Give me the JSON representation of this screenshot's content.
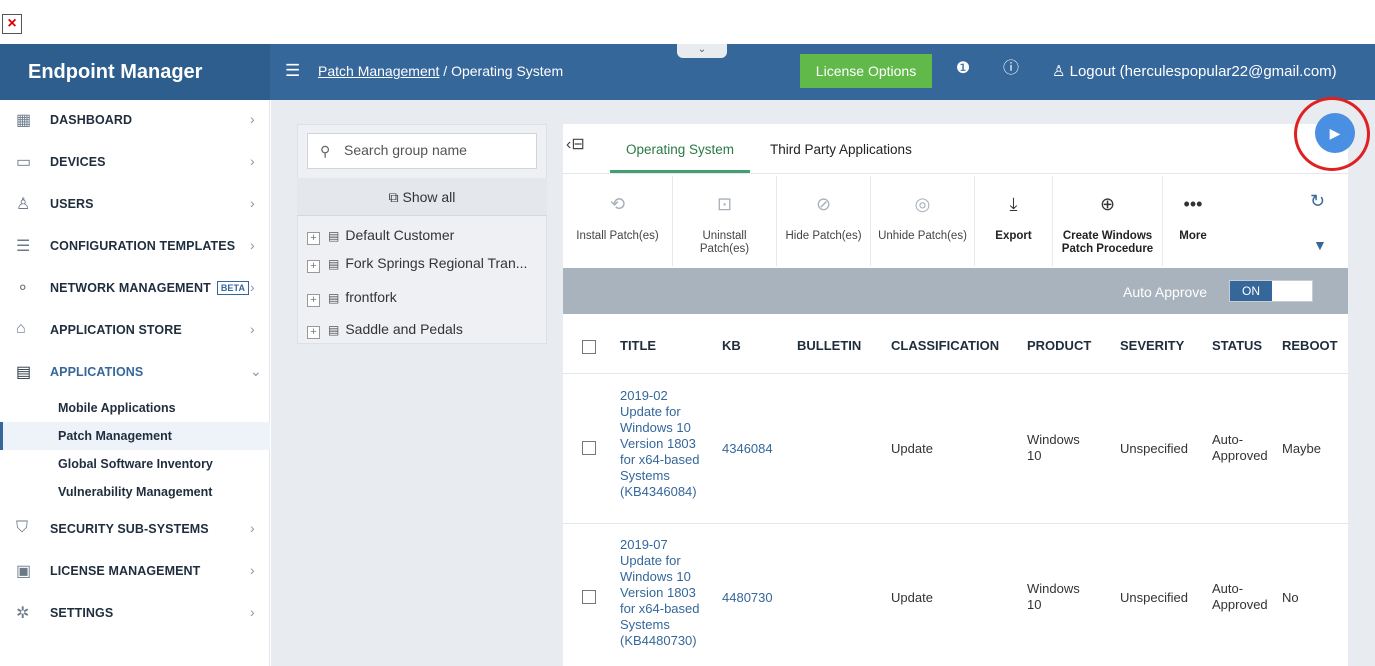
{
  "top": {
    "close_glyph": "×",
    "collapse_glyph": "⌄"
  },
  "brand": {
    "title": "Endpoint Manager"
  },
  "header": {
    "menu_icon": "hamburger-icon",
    "breadcrumb_link": "Patch Management",
    "breadcrumb_sep": " / ",
    "breadcrumb_current": "Operating System",
    "license_button": "License Options",
    "logout_text": "Logout (herculespopular22@gmail.com)"
  },
  "sidebar": {
    "items": [
      {
        "label": "DASHBOARD",
        "icon": "dashboard-grid-icon",
        "glyph": "▦"
      },
      {
        "label": "DEVICES",
        "icon": "monitor-icon",
        "glyph": "▭"
      },
      {
        "label": "USERS",
        "icon": "user-icon",
        "glyph": "♙"
      },
      {
        "label": "CONFIGURATION TEMPLATES",
        "icon": "template-icon",
        "glyph": "☰"
      },
      {
        "label": "NETWORK MANAGEMENT",
        "badge": "BETA",
        "icon": "network-icon",
        "glyph": "⚬"
      },
      {
        "label": "APPLICATION STORE",
        "icon": "store-icon",
        "glyph": "⌂"
      },
      {
        "label": "APPLICATIONS",
        "icon": "applications-icon",
        "glyph": "▤"
      },
      {
        "label": "SECURITY SUB-SYSTEMS",
        "icon": "shield-icon",
        "glyph": "⛉"
      },
      {
        "label": "LICENSE MANAGEMENT",
        "icon": "license-icon",
        "glyph": "▣"
      },
      {
        "label": "SETTINGS",
        "icon": "settings-gear-icon",
        "glyph": "✲"
      }
    ],
    "subitems": [
      "Mobile Applications",
      "Patch Management",
      "Global Software Inventory",
      "Vulnerability Management"
    ]
  },
  "groups": {
    "search_placeholder": "Search group name",
    "show_all": "Show all",
    "items": [
      "Default Customer",
      "Fork Springs Regional Tran...",
      "frontfork",
      "Saddle and Pedals"
    ]
  },
  "tabs": [
    "Operating System",
    "Third Party Applications"
  ],
  "toolbar": {
    "install": "Install Patch(es)",
    "uninstall_1": "Uninstall",
    "uninstall_2": "Patch(es)",
    "hide": "Hide Patch(es)",
    "unhide": "Unhide Patch(es)",
    "export": "Export",
    "create_1": "Create Windows",
    "create_2": "Patch Procedure",
    "more": "More"
  },
  "auto_approve": {
    "label": "Auto Approve",
    "state": "ON"
  },
  "table": {
    "columns": [
      "TITLE",
      "KB",
      "BULLETIN",
      "CLASSIFICATION",
      "PRODUCT",
      "SEVERITY",
      "STATUS",
      "REBOOT"
    ],
    "rows": [
      {
        "title_lines": [
          "2019-02",
          "Update for",
          "Windows 10",
          "Version 1803",
          "for x64-based",
          "Systems",
          "(KB4346084)"
        ],
        "kb": "4346084",
        "bulletin": "",
        "classification": "Update",
        "product_lines": [
          "Windows",
          "10"
        ],
        "severity": "Unspecified",
        "status_lines": [
          "Auto-",
          "Approved"
        ],
        "reboot": "Maybe"
      },
      {
        "title_lines": [
          "2019-07",
          "Update for",
          "Windows 10",
          "Version 1803",
          "for x64-based",
          "Systems",
          "(KB4480730)"
        ],
        "kb": "4480730",
        "bulletin": "",
        "classification": "Update",
        "product_lines": [
          "Windows",
          "10"
        ],
        "severity": "Unspecified",
        "status_lines": [
          "Auto-",
          "Approved"
        ],
        "reboot": "No"
      }
    ]
  },
  "colors": {
    "brand": "#2d5e8e",
    "header": "#35679b",
    "license_green": "#61b94a",
    "tab_active": "#41a06d",
    "link": "#35679b",
    "highlight_ring": "#e02020"
  }
}
